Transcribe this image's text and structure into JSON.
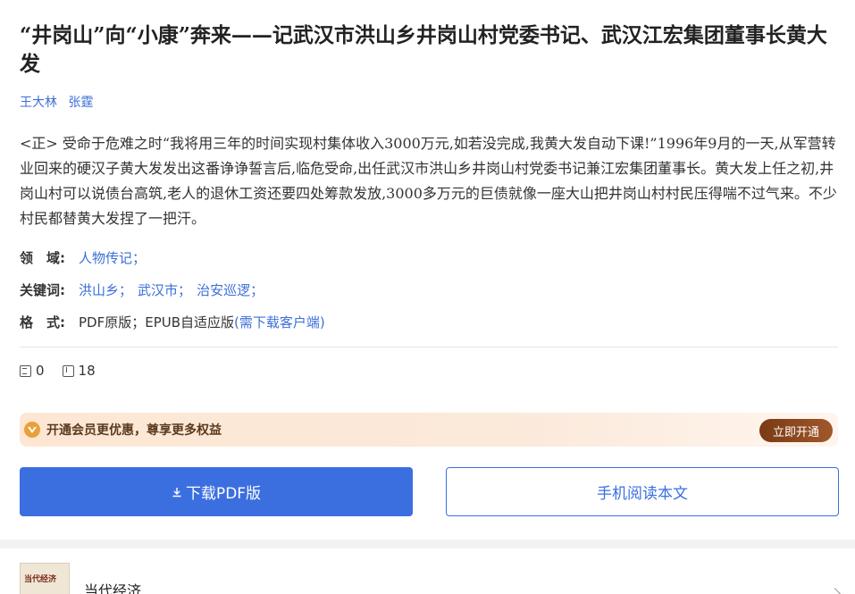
{
  "article": {
    "title": "“井岗山”向“小康”奔来——记武汉市洪山乡井岗山村党委书记、武汉江宏集团董事长黄大发",
    "authors": [
      "王大林",
      "张霆"
    ],
    "abstract": "<正> 受命于危难之时“我将用三年的时间实现村集体收入3000万元,如若没完成,我黄大发自动下课!”1996年9月的一天,从军营转业回来的硬汉子黄大发发出这番诤诤誓言后,临危受命,出任武汉市洪山乡井岗山村党委书记兼江宏集团董事长。黄大发上任之初,井岗山村可以说债台高筑,老人的退休工资还要四处筹款发放,3000多万元的巨债就像一座大山把井岗山村村民压得喘不过气来。不少村民都替黄大发捏了一把汗。"
  },
  "meta": {
    "field_label": "领　域:",
    "field_value": "人物传记",
    "keywords_label": "关键词:",
    "keywords": [
      "洪山乡",
      "武汉市",
      "治安巡逻"
    ],
    "format_label": "格　式:",
    "format_value": "PDF原版；EPUB自适应版",
    "format_note": "(需下载客户端)",
    "separator": "；"
  },
  "stats": {
    "views": "0",
    "downloads": "18"
  },
  "vip": {
    "text": "开通会员更优惠，尊享更多权益",
    "button": "立即开通"
  },
  "actions": {
    "download": "下载PDF版",
    "mobile": "手机阅读本文"
  },
  "journal": {
    "name": "当代经济",
    "thumb_text": "当代经济"
  },
  "colors": {
    "link": "#3c6fd7",
    "primary": "#3b6fe0",
    "vip_button": "#7a3a14"
  }
}
